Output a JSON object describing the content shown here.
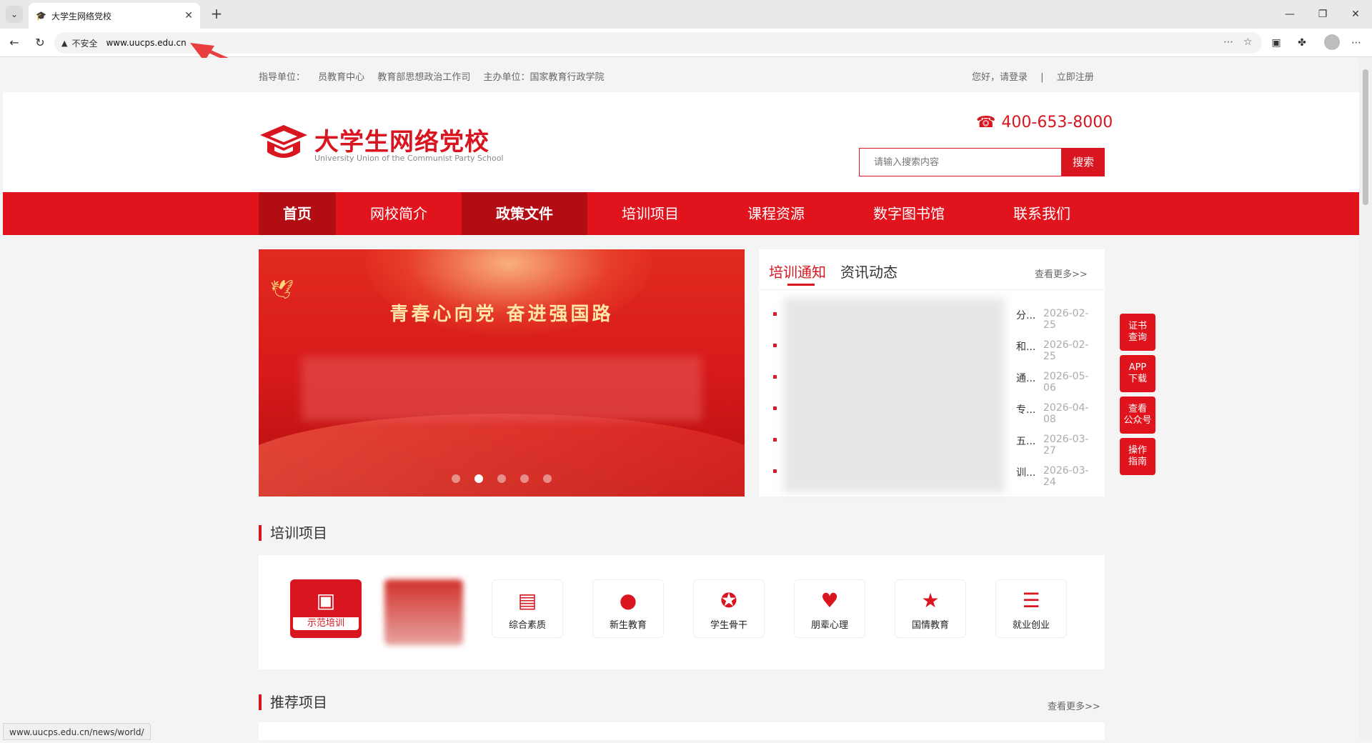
{
  "browser": {
    "tab_title": "大学生网络党校",
    "new_tab": "+",
    "insecure_label": "不安全",
    "url": "www.uucps.edu.cn",
    "status_url": "www.uucps.edu.cn/news/world/"
  },
  "topinfo": {
    "guide_label": "指导单位：",
    "guide_unit": "员教育中心",
    "guide_unit_2": "教育部思想政治工作司",
    "host_label": "主办单位：国家教育行政学院",
    "login": "您好，请登录",
    "separator": "|",
    "register": "立即注册"
  },
  "header": {
    "logo_title": "大学生网络党校",
    "logo_subtitle": "University Union of the Communist Party School",
    "phone": "400-653-8000",
    "search_placeholder": "请输入搜索内容",
    "search_button": "搜索"
  },
  "nav": {
    "items": [
      {
        "label": "首页"
      },
      {
        "label": "网校简介"
      },
      {
        "label": "政策文件"
      },
      {
        "label": "培训项目"
      },
      {
        "label": "课程资源"
      },
      {
        "label": "数字图书馆"
      },
      {
        "label": "联系我们"
      }
    ]
  },
  "banner": {
    "title": "青春心向党 奋进强国路"
  },
  "news": {
    "tab_active": "培训通知",
    "tab_other": "资讯动态",
    "more": "查看更多>>",
    "rows": [
      {
        "tail": "分...",
        "date": "2026-02-25"
      },
      {
        "tail": "和...",
        "date": "2026-02-25"
      },
      {
        "tail": "通...",
        "date": "2026-05-06"
      },
      {
        "tail": "专...",
        "date": "2026-04-08"
      },
      {
        "tail": "五...",
        "date": "2026-03-27"
      },
      {
        "tail": "训...",
        "date": "2026-03-24"
      }
    ]
  },
  "side_buttons": [
    {
      "line1": "证书",
      "line2": "查询"
    },
    {
      "line1": "APP",
      "line2": "下载"
    },
    {
      "line1": "查看",
      "line2": "公众号"
    },
    {
      "line1": "操作",
      "line2": "指南"
    }
  ],
  "sections": {
    "training": "培训项目",
    "recommended": "推荐项目",
    "recommended_more": "查看更多>>"
  },
  "projects": [
    {
      "label": "示范培训",
      "icon": "presentation-icon"
    },
    {
      "label": "综合素质",
      "icon": "book-icon"
    },
    {
      "label": "新生教育",
      "icon": "student-icon"
    },
    {
      "label": "学生骨干",
      "icon": "medal-icon"
    },
    {
      "label": "朋辈心理",
      "icon": "heart-hands-icon"
    },
    {
      "label": "国情教育",
      "icon": "flag-icon"
    },
    {
      "label": "就业创业",
      "icon": "document-icon"
    }
  ],
  "colors": {
    "brand_red": "#e1141d",
    "nav_active": "#b30d14"
  }
}
